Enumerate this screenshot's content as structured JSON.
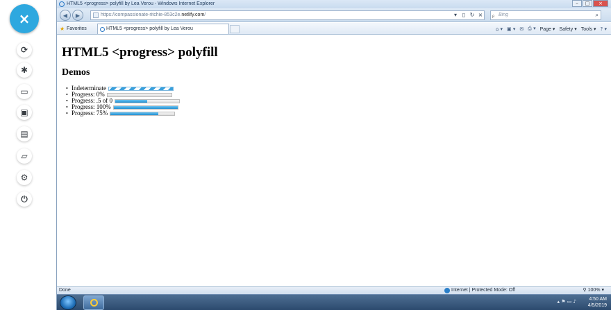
{
  "sidebar": {
    "close_glyph": "×",
    "tools": [
      {
        "name": "sync-icon",
        "glyph": "⟳"
      },
      {
        "name": "bug-icon",
        "glyph": "✱"
      },
      {
        "name": "video-camera-icon",
        "glyph": "▭"
      },
      {
        "name": "screenshot-icon",
        "glyph": "▣"
      },
      {
        "name": "monitor-icon",
        "glyph": "▤"
      },
      {
        "name": "folder-icon",
        "glyph": "▱"
      },
      {
        "name": "gear-icon",
        "glyph": "⚙"
      },
      {
        "name": "power-icon",
        "glyph": "⏻"
      }
    ]
  },
  "browser": {
    "window_title": "HTML5 <progress> polyfill by Lea Verou - Windows Internet Explorer",
    "address_prefix": "https://compassionate-ritchie-853c2e.",
    "address_host": "netlify.com",
    "address_suffix": "/",
    "search_placeholder": "Bing",
    "favorites_label": "Favorites",
    "tab_title": "HTML5 <progress> polyfill by Lea Verou",
    "commands": {
      "page": "Page ▾",
      "safety": "Safety ▾",
      "tools": "Tools ▾"
    },
    "status": {
      "left": "Done",
      "zone": "Internet | Protected Mode: Off",
      "zoom": "100%"
    }
  },
  "page": {
    "heading": "HTML5 <progress> polyfill",
    "demos_heading": "Demos",
    "demos": [
      {
        "label": "Indeterminate",
        "indeterminate": true
      },
      {
        "label": "Progress: 0%",
        "value": 0
      },
      {
        "label": "Progress: .5 of 0",
        "value": 0.5
      },
      {
        "label": "Progress: 100%",
        "value": 1
      },
      {
        "label": "Progress: 75%",
        "value": 0.75
      }
    ]
  },
  "taskbar": {
    "time": "4:50 AM",
    "date": "4/5/2019"
  }
}
